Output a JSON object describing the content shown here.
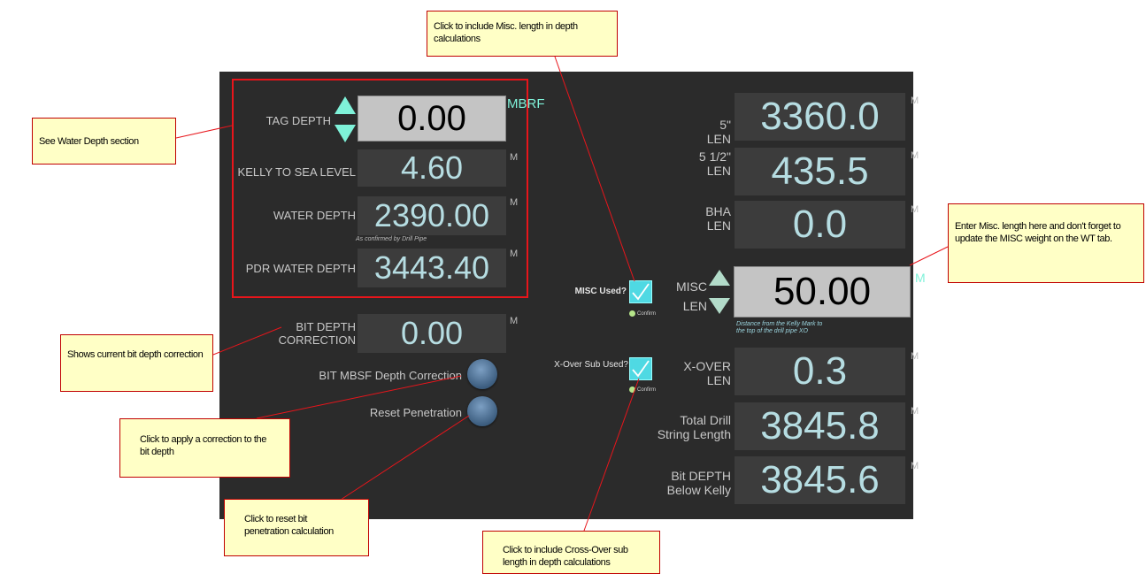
{
  "left": {
    "tag_depth": {
      "label": "TAG  DEPTH",
      "value": "0.00",
      "unit": "MBRF"
    },
    "kelly_sea": {
      "label": "KELLY TO SEA LEVEL",
      "value": "4.60",
      "unit": "M"
    },
    "water_depth": {
      "label": "WATER DEPTH",
      "value": "2390.00",
      "unit": "M",
      "note": "As confirmed by Drill Pipe"
    },
    "pdr_water": {
      "label": "PDR WATER DEPTH",
      "value": "3443.40",
      "unit": "M"
    },
    "bit_corr": {
      "label_line1": "BIT DEPTH",
      "label_line2": "CORRECTION",
      "value": "0.00",
      "unit": "M"
    },
    "bit_mbsf_label": "BIT MBSF Depth Correction",
    "reset_label": "Reset Penetration"
  },
  "middle": {
    "misc_used": "MISC Used?",
    "xover_used": "X-Over Sub Used?",
    "confirm": "Confirm"
  },
  "right": {
    "len5": {
      "line1": "5\"",
      "line2": "LEN",
      "value": "3360.0",
      "unit": "M"
    },
    "len512": {
      "line1": "5 1/2\"",
      "line2": "LEN",
      "value": "435.5",
      "unit": "M"
    },
    "bha": {
      "line1": "BHA",
      "line2": "LEN",
      "value": "0.0",
      "unit": "M"
    },
    "misc": {
      "line1": "MISC",
      "line2": "LEN",
      "value": "50.00",
      "unit": "M",
      "hint1": "Distance from the Kelly Mark to",
      "hint2": "the top of the drill pipe XO"
    },
    "xover": {
      "line1": "X-OVER",
      "line2": "LEN",
      "value": "0.3",
      "unit": "M"
    },
    "total": {
      "line1": "Total Drill",
      "line2": "String Length",
      "value": "3845.8",
      "unit": "M"
    },
    "bitdepth": {
      "line1": "Bit DEPTH",
      "line2": "Below Kelly",
      "value": "3845.6",
      "unit": "M"
    }
  },
  "callouts": {
    "misc_include": "Click to include Misc. length in depth calculations",
    "water_section": "See Water Depth section",
    "misc_enter": "Enter Misc.  length here and don't forget to update the MISC weight on the WT tab.",
    "bit_corr_show": "Shows current bit depth correction",
    "apply_corr": "Click to apply a correction to the bit depth",
    "reset_pen": "Click to reset bit penetration calculation",
    "xover_include": "Click to include Cross-Over sub length in depth calculations"
  },
  "colors": {
    "panel_bg": "#2b2b2b",
    "value_box": "#3c3c3c",
    "value_text": "#b6dde2",
    "input_box": "#c4c4c4",
    "accent_arrow": "#7ff2d9",
    "red_outline": "#e8151b",
    "callout_bg": "#ffffc6"
  }
}
